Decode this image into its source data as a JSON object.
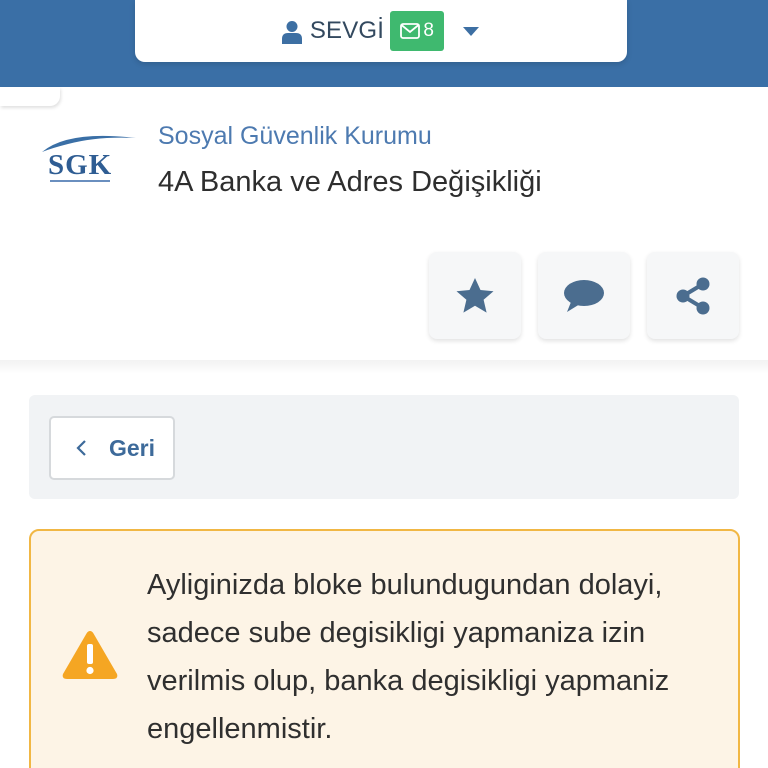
{
  "header": {
    "user_name": "SEVGİ",
    "mail_count": "8",
    "user_icon": "user-icon",
    "mail_icon": "envelope-icon",
    "dropdown_icon": "caret-down-icon"
  },
  "institution": {
    "logo_text": "SGK",
    "name": "Sosyal Güvenlik Kurumu",
    "service_title": "4A Banka ve Adres Değişikliği"
  },
  "actions": [
    {
      "name": "favorite",
      "icon": "star-icon"
    },
    {
      "name": "comment",
      "icon": "comment-icon"
    },
    {
      "name": "share",
      "icon": "share-icon"
    }
  ],
  "navigation": {
    "back_label": "Geri",
    "back_icon": "chevron-left-icon"
  },
  "warning": {
    "icon": "warning-icon",
    "message": "Ayliginizda bloke bulundugundan dolayi, sadece sube degisikligi yapmaniza izin verilmis olup, banka degisikligi yapmaniz engellenmistir."
  },
  "colors": {
    "header_blue": "#3a6fa6",
    "badge_green": "#3fb96f",
    "link_blue": "#4d7ab0",
    "warning_border": "#f1b744",
    "warning_bg": "#fdf4e6",
    "warning_icon": "#f5a623"
  }
}
